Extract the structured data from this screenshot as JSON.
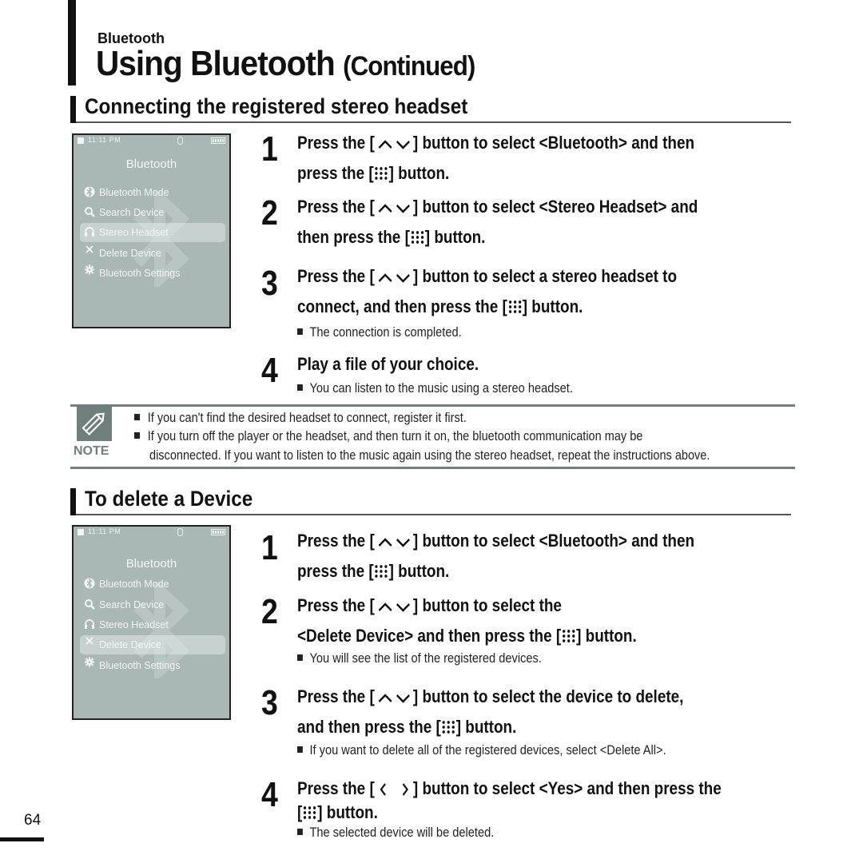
{
  "header": {
    "category": "Bluetooth",
    "title": "Using Bluetooth",
    "title_suffix": "(Continued)"
  },
  "section1": {
    "heading": "Connecting the registered stereo headset",
    "screen": {
      "status_time": "11:11 PM",
      "title": "Bluetooth",
      "items": [
        {
          "icon": "bluetooth-icon",
          "glyph": "ʙ",
          "label": "Bluetooth Mode"
        },
        {
          "icon": "search-icon",
          "glyph": "🔍",
          "label": "Search Device"
        },
        {
          "icon": "headphones-icon",
          "glyph": "∩",
          "label": "Stereo Headset",
          "selected": true
        },
        {
          "icon": "close-icon",
          "glyph": "✕",
          "label": "Delete Device"
        },
        {
          "icon": "gear-icon",
          "glyph": "✹",
          "label": "Bluetooth Settings"
        }
      ]
    },
    "steps": [
      {
        "number": "1",
        "lines": [
          {
            "pre": "Press the [",
            "icon": "up-down",
            "post": "] button to select <Bluetooth> and then"
          },
          {
            "pre": "press the [",
            "icon": "menu",
            "post": "] button."
          }
        ]
      },
      {
        "number": "2",
        "lines": [
          {
            "pre": "Press the [",
            "icon": "up-down",
            "post": "] button to select <Stereo Headset> and"
          },
          {
            "pre": "then press the [",
            "icon": "menu",
            "post": "] button."
          }
        ]
      },
      {
        "number": "3",
        "lines": [
          {
            "pre": "Press the [",
            "icon": "up-down",
            "post": "] button to select a stereo headset to"
          },
          {
            "pre": "connect, and then press the [",
            "icon": "menu",
            "post": "] button."
          }
        ],
        "sub": "The connection is completed."
      },
      {
        "number": "4",
        "lines": [
          {
            "pre": "Play a file of your choice.",
            "icon": "",
            "post": ""
          }
        ],
        "sub": "You can listen to the music using a stereo headset."
      }
    ]
  },
  "note": {
    "label": "NOTE",
    "lines": [
      "If you can't find the desired headset to connect, register it first.",
      "If you turn off the player or the headset, and then turn it on, the bluetooth communication may be",
      "disconnected. If you want to listen to the music again using the stereo headset, repeat the instructions above."
    ]
  },
  "section2": {
    "heading": "To delete a Device",
    "screen": {
      "status_time": "11:11 PM",
      "title": "Bluetooth",
      "items": [
        {
          "icon": "bluetooth-icon",
          "glyph": "ʙ",
          "label": "Bluetooth Mode"
        },
        {
          "icon": "search-icon",
          "glyph": "🔍",
          "label": "Search Device"
        },
        {
          "icon": "headphones-icon",
          "glyph": "∩",
          "label": "Stereo Headset"
        },
        {
          "icon": "close-icon",
          "glyph": "✕",
          "label": "Delete Device",
          "selected": true
        },
        {
          "icon": "gear-icon",
          "glyph": "✹",
          "label": "Bluetooth Settings"
        }
      ]
    },
    "steps": [
      {
        "number": "1",
        "lines": [
          {
            "pre": "Press the [",
            "icon": "up-down",
            "post": "] button to select <Bluetooth> and then"
          },
          {
            "pre": "press the [",
            "icon": "menu",
            "post": "] button."
          }
        ]
      },
      {
        "number": "2",
        "lines": [
          {
            "pre": "Press the [",
            "icon": "up-down",
            "post": "] button to select the"
          },
          {
            "pre": "<Delete Device> and then press the [",
            "icon": "menu",
            "post": "] button."
          }
        ],
        "sub": "You will see the list of the registered devices."
      },
      {
        "number": "3",
        "lines": [
          {
            "pre": "Press the [",
            "icon": "up-down",
            "post": "] button to select the device to delete,"
          },
          {
            "pre": "and then press the [",
            "icon": "menu",
            "post": "] button."
          }
        ],
        "sub": "If you want to delete all of the registered devices, select <Delete All>."
      },
      {
        "number": "4",
        "lines": [
          {
            "pre": "Press the [",
            "icon": "left-right",
            "post": "] button to select <Yes> and then press the"
          },
          {
            "pre": "[",
            "icon": "menu",
            "post": "] button."
          }
        ],
        "sub": "The selected device will be deleted."
      }
    ]
  },
  "page_number": "64"
}
